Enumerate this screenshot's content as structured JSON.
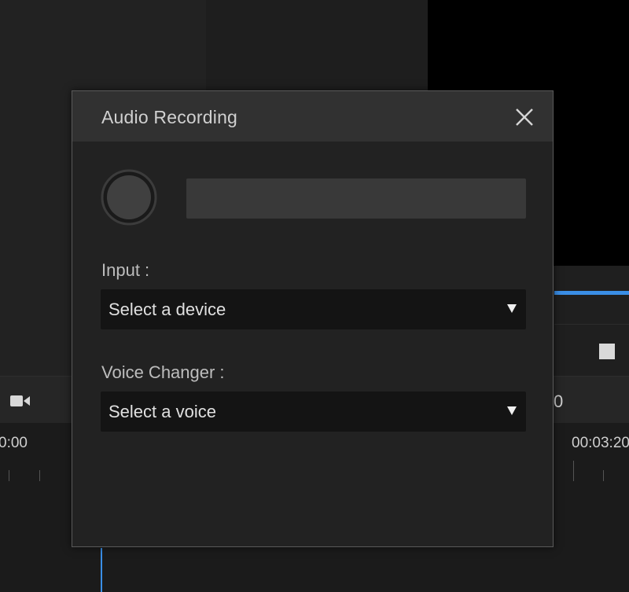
{
  "dialog": {
    "title": "Audio Recording",
    "close_icon": "close-icon",
    "record_icon": "record-icon",
    "level": 0,
    "input_label": "Input :",
    "input_value": "Select a device",
    "voice_label": "Voice Changer :",
    "voice_value": "Select a voice"
  },
  "background": {
    "timecode_left": "0:00",
    "timecode_right": "00:03:20",
    "toolbar_glyph": "0",
    "camera_icon": "video-camera-icon",
    "stop_icon": "stop-icon"
  },
  "colors": {
    "accent": "#3a8ee6",
    "dialog_bg": "#222222",
    "header_bg": "#313131",
    "select_bg": "#141414"
  }
}
